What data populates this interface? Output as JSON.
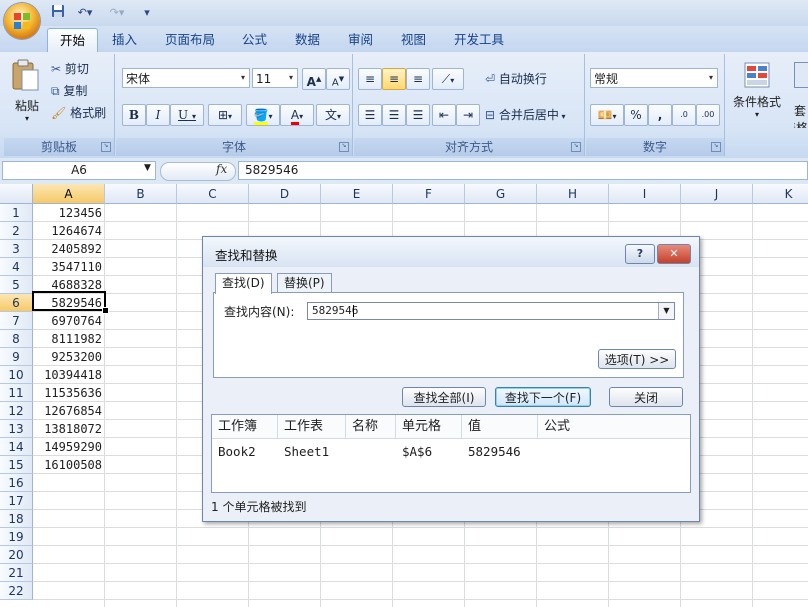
{
  "ribbon": {
    "tabs": [
      "开始",
      "插入",
      "页面布局",
      "公式",
      "数据",
      "审阅",
      "视图",
      "开发工具"
    ],
    "clipboard": {
      "paste": "粘贴",
      "cut": "剪切",
      "copy": "复制",
      "format_painter": "格式刷",
      "label": "剪贴板"
    },
    "font": {
      "name": "宋体",
      "size": "11",
      "bold": "B",
      "italic": "I",
      "underline": "U",
      "grow": "A",
      "shrink": "A",
      "color_letter": "A",
      "phonetic": "文",
      "label": "字体"
    },
    "alignment": {
      "wrap": "自动换行",
      "merge": "合并后居中",
      "label": "对齐方式"
    },
    "number": {
      "format": "常规",
      "percent": "%",
      "comma": ",",
      "inc_decimal": ".0",
      "dec_decimal": ".00",
      "label": "数字"
    },
    "styles": {
      "conditional": "条件格式",
      "table_part": "套",
      "table_part2": "表格"
    }
  },
  "formula_bar": {
    "name_box": "A6",
    "fx": "fx",
    "content": "5829546"
  },
  "grid": {
    "columns": [
      "A",
      "B",
      "C",
      "D",
      "E",
      "F",
      "G",
      "H",
      "I",
      "J",
      "K"
    ],
    "rows": [
      "1",
      "2",
      "3",
      "4",
      "5",
      "6",
      "7",
      "8",
      "9",
      "10",
      "11",
      "12",
      "13",
      "14",
      "15",
      "16",
      "17",
      "18",
      "19",
      "20",
      "21",
      "22"
    ],
    "column_a": [
      "123456",
      "1264674",
      "2405892",
      "3547110",
      "4688328",
      "5829546",
      "6970764",
      "8111982",
      "9253200",
      "10394418",
      "11535636",
      "12676854",
      "13818072",
      "14959290",
      "16100508"
    ]
  },
  "dialog": {
    "title": "查找和替换",
    "help": "?",
    "close": "✕",
    "tabs": [
      "查找(D)",
      "替换(P)"
    ],
    "find_label": "查找内容(N):",
    "find_value": "5829546",
    "options": "选项(T) >>",
    "find_all": "查找全部(I)",
    "find_next": "查找下一个(F)",
    "close_btn": "关闭",
    "headers": [
      "工作簿",
      "工作表",
      "名称",
      "单元格",
      "值",
      "公式"
    ],
    "result": {
      "book": "Book2",
      "sheet": "Sheet1",
      "name": "",
      "cell": "$A$6",
      "value": "5829546",
      "formula": ""
    },
    "status": "1 个单元格被找到"
  },
  "colors": {
    "accent": "#15428b",
    "selection": "#f7c966",
    "ribbon_bg": "#dbe6f5"
  }
}
